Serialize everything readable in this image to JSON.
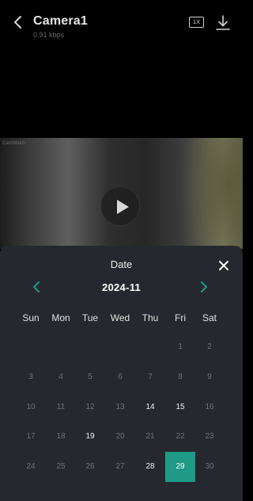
{
  "header": {
    "title": "Camera1",
    "bitrate": "0.91 kbps",
    "speed_label": "1X"
  },
  "video": {
    "stamp": "CamWatch"
  },
  "date_picker": {
    "title": "Date",
    "month": "2024-11",
    "weekdays": [
      "Sun",
      "Mon",
      "Tue",
      "Wed",
      "Thu",
      "Fri",
      "Sat"
    ],
    "rows": [
      [
        "",
        "",
        "",
        "",
        "",
        "1",
        "2"
      ],
      [
        "3",
        "4",
        "5",
        "6",
        "7",
        "8",
        "9"
      ],
      [
        "10",
        "11",
        "12",
        "13",
        "14",
        "15",
        "16"
      ],
      [
        "17",
        "18",
        "19",
        "20",
        "21",
        "22",
        "23"
      ],
      [
        "24",
        "25",
        "26",
        "27",
        "28",
        "29",
        "30"
      ]
    ],
    "days_with_video": [
      "14",
      "15",
      "19",
      "28",
      "29"
    ],
    "selected_day": "29",
    "accent_color": "#1e9a86"
  }
}
